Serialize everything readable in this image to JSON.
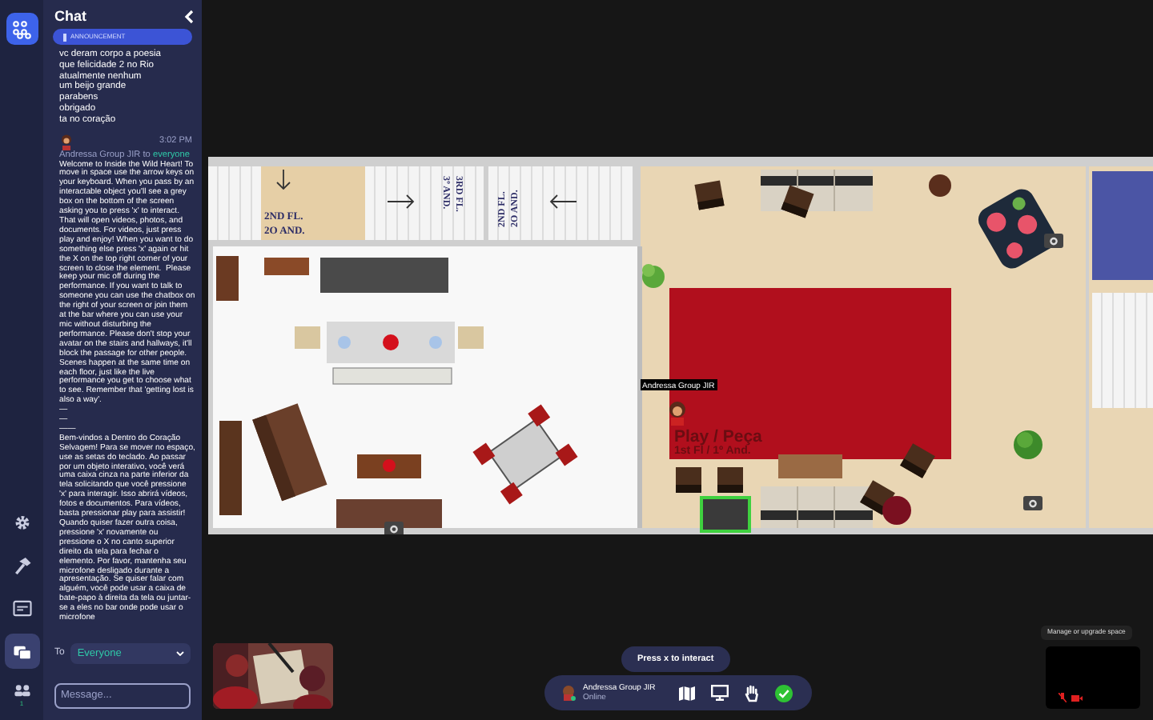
{
  "rail": {
    "items": [
      {
        "kind": "gear",
        "selected": false
      },
      {
        "kind": "hammer",
        "selected": false
      },
      {
        "kind": "screen",
        "selected": false
      },
      {
        "kind": "chat",
        "selected": true
      },
      {
        "kind": "people",
        "selected": false,
        "badge": "1"
      }
    ]
  },
  "chat": {
    "title": "Chat",
    "announcement": "ANNOUNCEMENT",
    "messages": [
      {
        "lines": [
          "vc deram corpo a poesia",
          "que felicidade 2 no Rio",
          "atualmente nenhum",
          "um beijo grande",
          "parabens",
          "obrigado",
          "ta no coração"
        ]
      },
      {
        "time": "3:02 PM",
        "sender": "Andressa Group JIR",
        "to": "to",
        "recipient": "everyone",
        "paragraphs": [
          "Welcome to Inside the Wild Heart! To move in space use the arrow keys on your keyboard. When you pass by an interactable object you'll see a grey box on the bottom of the screen asking you to press 'x' to interact. That will open videos, photos, and documents. For videos, just press play and enjoy! When you want to do something else press 'x' again or hit the X on the top right corner of your screen to close the element.  Please keep your mic off during the performance. If you want to talk to someone you can use the chatbox on the right of your screen or join them at the bar where you can use your mic without disturbing the performance. Please don't stop your avatar on the stairs and hallways, it'll block the passage for other people.  Scenes happen at the same time on each floor, just like the live performance you get to choose what to see. Remember that 'getting lost is also a way'.",
          "—",
          "—",
          "——",
          "Bem-vindos a Dentro do Coração Selvagem! Para se mover no espaço, use as setas do teclado. Ao passar por um objeto interativo, você verá uma caixa cinza na parte inferior da tela solicitando que você pressione 'x' para interagir. Isso abrirá vídeos, fotos e documentos. Para vídeos, basta pressionar play para assistir! Quando quiser fazer outra coisa, pressione 'x' novamente ou pressione o X no canto superior direito da tela para fechar o elemento. Por favor, mantenha seu microfone desligado durante a apresentação. Se quiser falar com alguém, você pode usar a caixa de bate-papo à direita da tela ou juntar-se a eles no bar onde pode usar o microfone"
        ]
      }
    ],
    "to_label": "To",
    "recipient_select": "Everyone",
    "message_field": {
      "placeholder": "Message..."
    }
  },
  "map": {
    "labels": [
      {
        "kind": "flat",
        "lines": [
          "2ND FL.",
          "2O AND."
        ]
      },
      {
        "kind": "down",
        "lines": [
          "3RD FL.",
          "3º AND."
        ]
      },
      {
        "kind": "up",
        "lines": [
          "2ND FL.",
          "2O AND."
        ]
      }
    ],
    "player_name": "Andressa Group JIR",
    "scene_title": "Play / Peça",
    "scene_floor": "1st Fl / 1º And."
  },
  "interact_hint": "Press x to interact",
  "toolbar": {
    "name": "Andressa Group JIR",
    "status": "Online"
  },
  "manage_button": "Manage or upgrade space"
}
